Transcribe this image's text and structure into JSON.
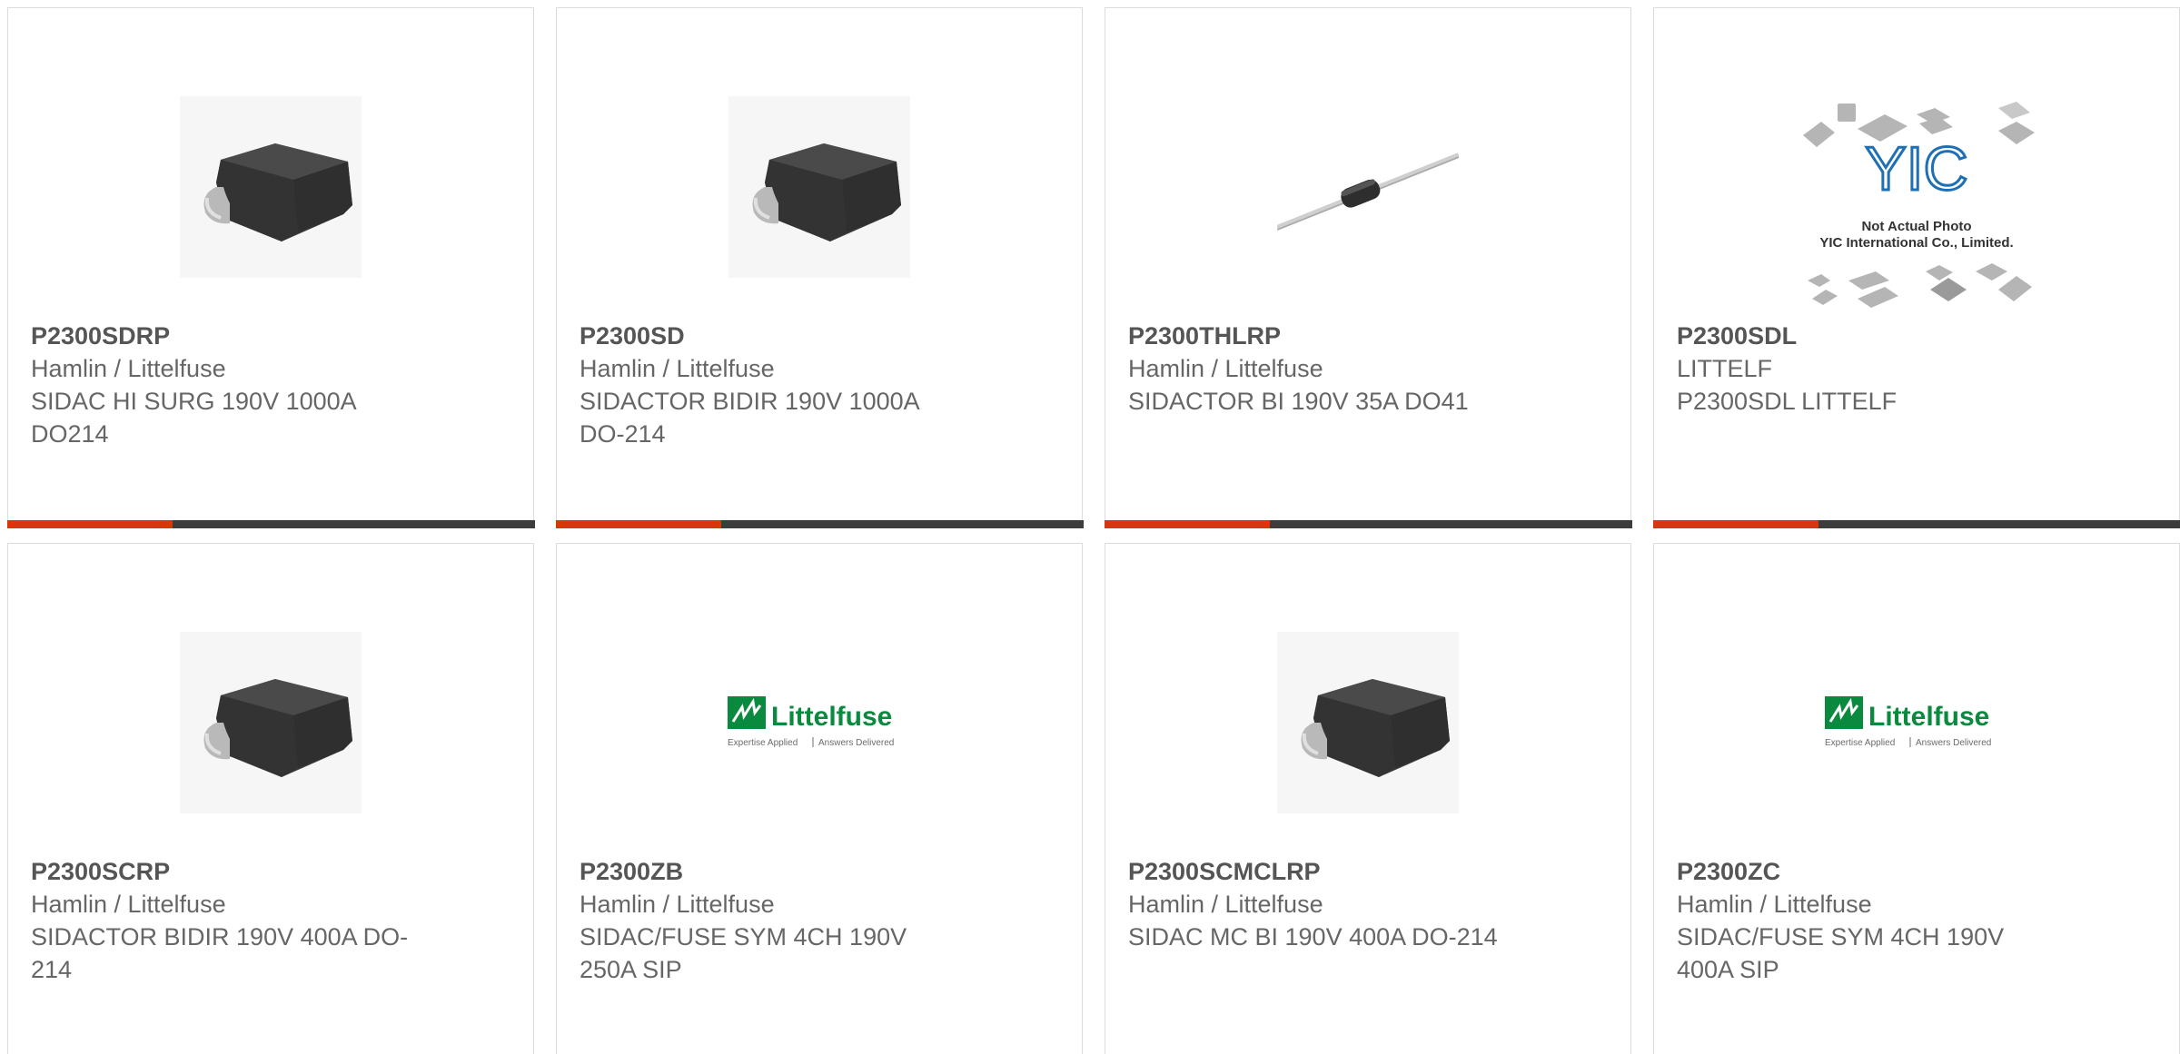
{
  "products": [
    {
      "part": "P2300SDRP",
      "manufacturer": "Hamlin / Littelfuse",
      "description": "SIDAC HI SURG 190V 1000A DO214",
      "image": "smd-package-icon"
    },
    {
      "part": "P2300SD",
      "manufacturer": "Hamlin / Littelfuse",
      "description": "SIDACTOR BIDIR 190V 1000A DO-214",
      "image": "smd-package-icon"
    },
    {
      "part": "P2300THLRP",
      "manufacturer": "Hamlin / Littelfuse",
      "description": "SIDACTOR BI 190V 35A DO41",
      "image": "axial-diode-icon"
    },
    {
      "part": "P2300SDL",
      "manufacturer": "LITTELF",
      "description": "P2300SDL LITTELF",
      "image": "yic-placeholder-image",
      "placeholder_text": {
        "brand": "YIC",
        "line1": "Not Actual Photo",
        "line2": "YIC International Co., Limited."
      }
    },
    {
      "part": "P2300SCRP",
      "manufacturer": "Hamlin / Littelfuse",
      "description": "SIDACTOR BIDIR 190V 400A DO-214",
      "image": "smd-package-icon"
    },
    {
      "part": "P2300ZB",
      "manufacturer": "Hamlin / Littelfuse",
      "description": "SIDAC/FUSE SYM 4CH 190V 250A SIP",
      "image": "littelfuse-logo",
      "logo_text": {
        "brand": "Littelfuse",
        "tagline_left": "Expertise Applied",
        "tagline_right": "Answers Delivered"
      }
    },
    {
      "part": "P2300SCMCLRP",
      "manufacturer": "Hamlin / Littelfuse",
      "description": "SIDAC MC BI 190V 400A DO-214",
      "image": "smd-package-icon"
    },
    {
      "part": "P2300ZC",
      "manufacturer": "Hamlin / Littelfuse",
      "description": "SIDAC/FUSE SYM 4CH 190V 400A SIP",
      "image": "littelfuse-logo",
      "logo_text": {
        "brand": "Littelfuse",
        "tagline_left": "Expertise Applied",
        "tagline_right": "Answers Delivered"
      }
    }
  ],
  "colors": {
    "accent": "#d8360c",
    "bar": "#3c3c3c",
    "border": "#dcdcdc",
    "text": "#666666",
    "logo_green": "#0a8a3e"
  }
}
